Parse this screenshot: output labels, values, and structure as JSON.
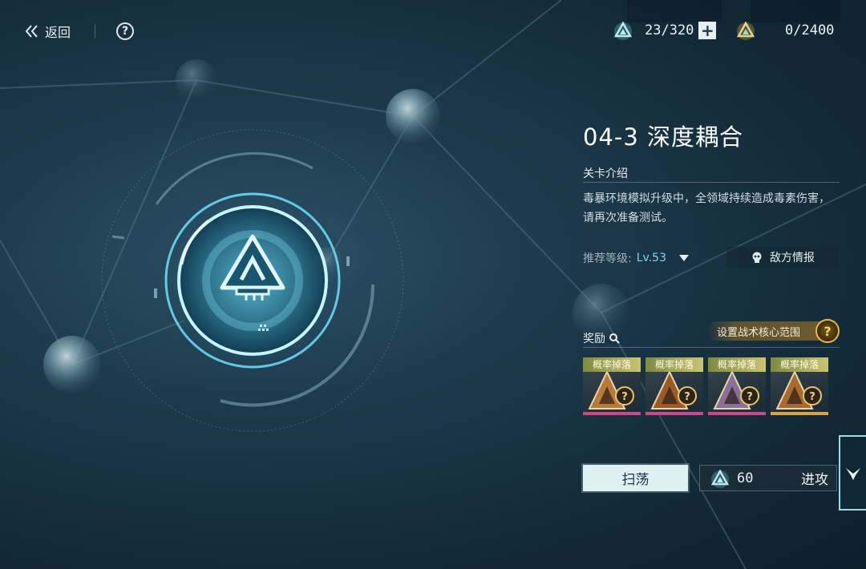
{
  "topbar": {
    "back_label": "返回",
    "help_label": "?"
  },
  "resources": {
    "stamina": "23/320",
    "stamina_plus": "+",
    "currency": "0/2400",
    "stamina_icon": "energy-triangle-icon",
    "currency_icon": "gold-triangle-icon"
  },
  "stage": {
    "title": "04-3 深度耦合",
    "intro_label": "关卡介绍",
    "description": "毒暴环境模拟升级中，全领域持续造成毒素伤害，请再次准备测试。",
    "recommend_label": "推荐等级:",
    "recommend_level": "Lv.53",
    "enemy_intel": "敌方情报"
  },
  "rewards": {
    "label": "奖励",
    "core_range": "设置战术核心范围",
    "core_help": "?",
    "items": [
      {
        "tag": "概率掉落",
        "stripe": "#c44b8e",
        "tint": "#b87a3a"
      },
      {
        "tag": "概率掉落",
        "stripe": "#c44b8e",
        "tint": "#9c5a2a"
      },
      {
        "tag": "概率掉落",
        "stripe": "#c44b8e",
        "tint": "#8a6e9c"
      },
      {
        "tag": "概率掉落",
        "stripe": "#d6a24a",
        "tint": "#a86a32"
      }
    ]
  },
  "actions": {
    "sweep": "扫荡",
    "attack_cost": "60",
    "attack": "进攻"
  },
  "colors": {
    "accent_cyan": "#7fd4ec",
    "gold": "#e7b94c"
  }
}
